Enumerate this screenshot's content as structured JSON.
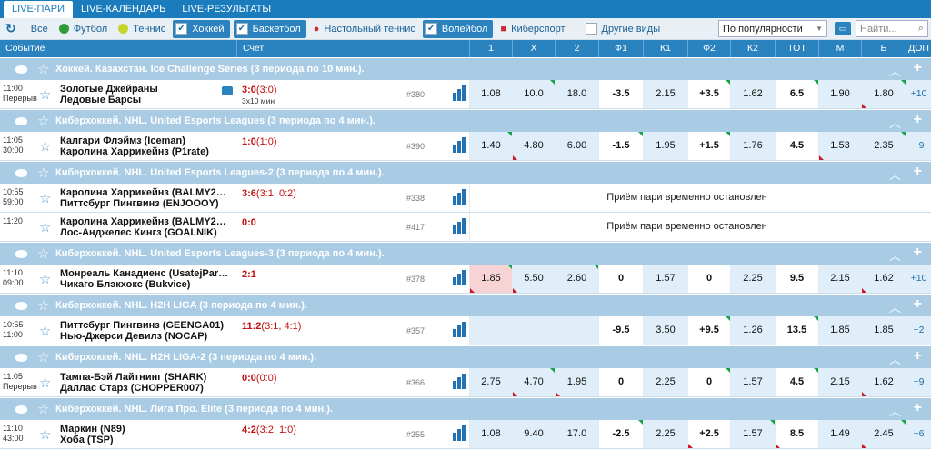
{
  "top_tabs": [
    "LIVE-ПАРИ",
    "LIVE-КАЛЕНДАРЬ",
    "LIVE-РЕЗУЛЬТАТЫ"
  ],
  "filters": {
    "all": "Все",
    "football": "Футбол",
    "tennis": "Теннис",
    "hockey": "Хоккей",
    "basketball": "Баскетбол",
    "table_tennis": "Настольный теннис",
    "volleyball": "Волейбол",
    "esports": "Киберспорт",
    "other": "Другие виды"
  },
  "sort": {
    "value": "По популярности"
  },
  "search": {
    "placeholder": "Найти..."
  },
  "columns": {
    "event": "Событие",
    "score": "Счет",
    "c1": "1",
    "cx": "X",
    "c2": "2",
    "f1": "Ф1",
    "k1": "К1",
    "f2": "Ф2",
    "k2": "К2",
    "tot": "ТОТ",
    "m": "М",
    "b": "Б",
    "dop": "ДОП"
  },
  "suspended_text": "Приём пари временно остановлен",
  "leagues": [
    {
      "title": "Хоккей. Казахстан. Ice Challenge Series (3 периода по 10 мин.).",
      "events": [
        {
          "time": "11:00",
          "status": "Перерыв",
          "team1": "Золотые Джейраны",
          "team2": "Ледовые Барсы",
          "tv": true,
          "score": "3:0",
          "periods": "(3:0)",
          "sub": "3x10 мин",
          "num": "#380",
          "odds": [
            "1.08",
            "10.0",
            "18.0",
            "-3.5",
            "2.15",
            "+3.5",
            "1.62",
            "6.5",
            "1.90",
            "1.80"
          ],
          "more": "+10"
        }
      ]
    },
    {
      "title": "Киберхоккей. NHL. United Esports Leagues (3 периода по 4 мин.).",
      "events": [
        {
          "time": "11:05",
          "status": "30:00",
          "team1": "Калгари Флэймз (Iceman)",
          "team2": "Каролина Харрикейнз (P1rate)",
          "score": "1:0",
          "periods": "(1:0)",
          "num": "#390",
          "odds": [
            "1.40",
            "4.80",
            "6.00",
            "-1.5",
            "1.95",
            "+1.5",
            "1.76",
            "4.5",
            "1.53",
            "2.35"
          ],
          "more": "+9"
        }
      ]
    },
    {
      "title": "Киберхоккей. NHL. United Esports Leagues-2 (3 периода по 4 мин.).",
      "events": [
        {
          "time": "10:55",
          "status": "59:00",
          "team1": "Каролина Харрикейнз (BALMY2…",
          "team2": "Питтсбург Пингвинз (ENJOOOY)",
          "score": "3:6",
          "periods": "(3:1, 0:2)",
          "num": "#338",
          "suspended": true
        },
        {
          "time": "11:20",
          "status": "",
          "team1": "Каролина Харрикейнз (BALMY2…",
          "team2": "Лос-Анджелес Кингз (GOALNIK)",
          "score": "0:0",
          "periods": "",
          "num": "#417",
          "suspended": true
        }
      ]
    },
    {
      "title": "Киберхоккей. NHL. United Esports Leagues-3 (3 периода по 4 мин.).",
      "events": [
        {
          "time": "11:10",
          "status": "09:00",
          "team1": "Монреаль Канадиенс (UsatejPar…",
          "team2": "Чикаго Блэкхокс (Bukvice)",
          "score": "2:1",
          "periods": "",
          "num": "#378",
          "odds": [
            "1.85",
            "5.50",
            "2.60",
            "0",
            "1.57",
            "0",
            "2.25",
            "9.5",
            "2.15",
            "1.62"
          ],
          "more": "+10"
        }
      ]
    },
    {
      "title": "Киберхоккей. NHL. H2H LIGA (3 периода по 4 мин.).",
      "events": [
        {
          "time": "10:55",
          "status": "11:00",
          "team1": "Питтсбург Пингвинз (GEENGA01)",
          "team2": "Нью-Джерси Девилз (NOCAP)",
          "score": "11:2",
          "periods": "(3:1, 4:1)",
          "num": "#357",
          "odds": [
            "",
            "",
            "",
            "-9.5",
            "3.50",
            "+9.5",
            "1.26",
            "13.5",
            "1.85",
            "1.85"
          ],
          "more": "+2"
        }
      ]
    },
    {
      "title": "Киберхоккей. NHL. H2H LIGA-2 (3 периода по 4 мин.).",
      "events": [
        {
          "time": "11:05",
          "status": "Перерыв",
          "team1": "Тампа-Бэй Лайтнинг (SHARK)",
          "team2": "Даллас Старз (CHOPPER007)",
          "score": "0:0",
          "periods": "(0:0)",
          "num": "#366",
          "odds": [
            "2.75",
            "4.70",
            "1.95",
            "0",
            "2.25",
            "0",
            "1.57",
            "4.5",
            "2.15",
            "1.62"
          ],
          "more": "+9"
        }
      ]
    },
    {
      "title": "Киберхоккей. NHL. Лига Про. Elite (3 периода по 4 мин.).",
      "events": [
        {
          "time": "11:10",
          "status": "43:00",
          "team1": "Маркин (N89)",
          "team2": "Хоба (TSP)",
          "score": "4:2",
          "periods": "(3:2, 1:0)",
          "num": "#355",
          "odds": [
            "1.08",
            "9.40",
            "17.0",
            "-2.5",
            "2.25",
            "+2.5",
            "1.57",
            "8.5",
            "1.49",
            "2.45"
          ],
          "more": "+6"
        }
      ]
    }
  ]
}
